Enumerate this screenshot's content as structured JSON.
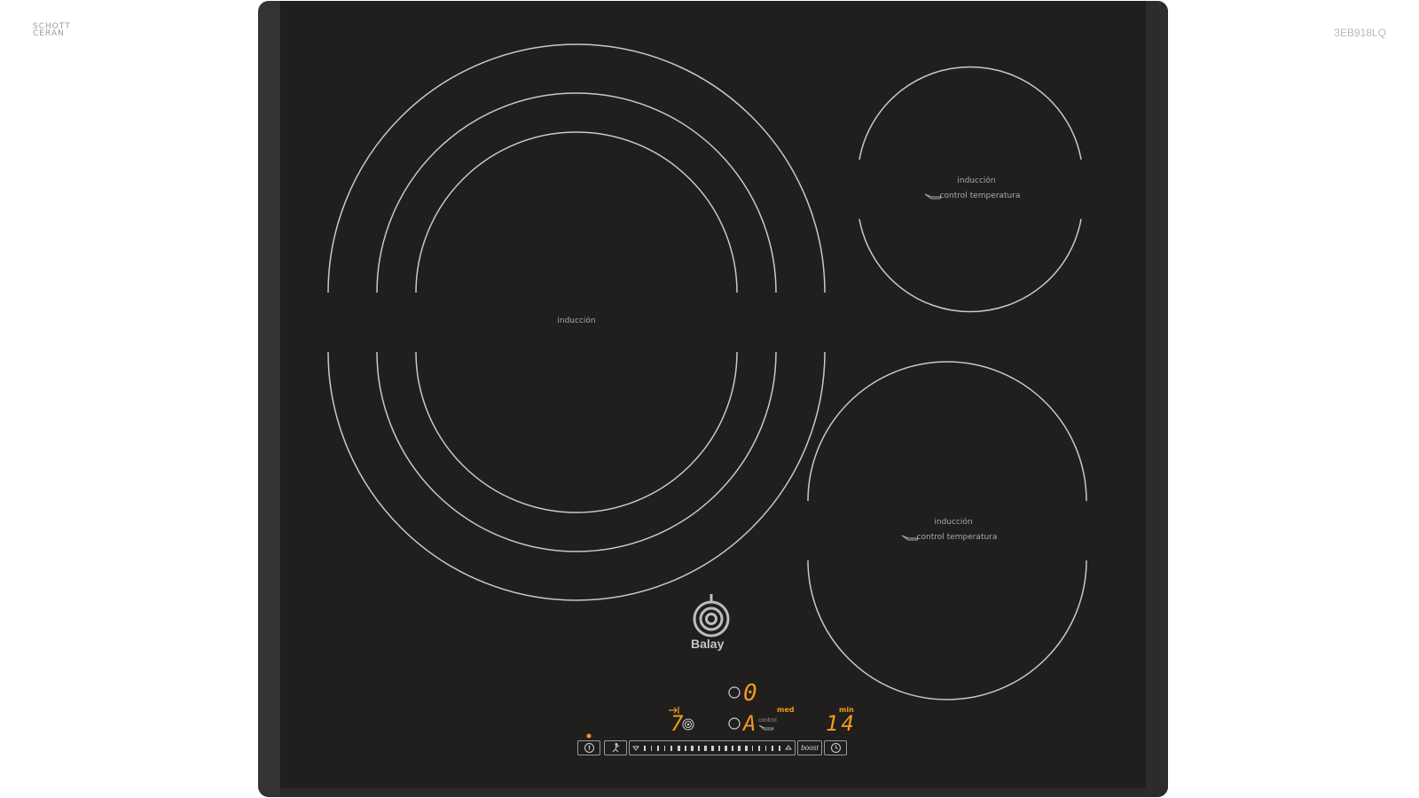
{
  "cooktop": {
    "brand_top_left": "SCHOTT CERAN",
    "model": "3EB918LQ",
    "brand_logo_text": "Balay",
    "colors": {
      "glass": "#201f1d",
      "frame": "#333333",
      "ring": "#c9c9c9",
      "display_orange": "#f29a1e"
    },
    "zones": [
      {
        "id": "large",
        "label": "inducción",
        "sublabel": ""
      },
      {
        "id": "top-right",
        "label": "inducción",
        "sublabel": "control temperatura"
      },
      {
        "id": "bottom-right",
        "label": "inducción",
        "sublabel": "control temperatura"
      }
    ]
  },
  "display": {
    "top_value": "0",
    "level_value": "7",
    "auto_value": "A",
    "control_label": "control",
    "med_label": "med",
    "min_label": "min",
    "timer_value": "14"
  },
  "controls": {
    "boost_label": "boost",
    "power_icon": "power-icon",
    "clean_icon": "wipe-protect-icon",
    "timer_icon": "clock-icon"
  }
}
